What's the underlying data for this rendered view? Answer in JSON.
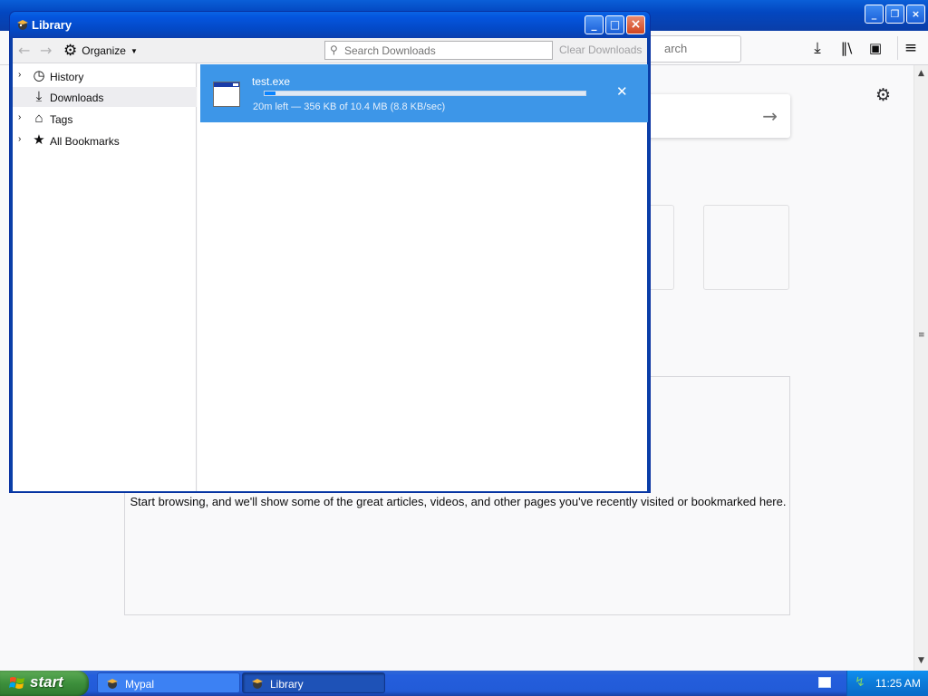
{
  "background_browser": {
    "search_placeholder": "arch",
    "new_tab_message": "Start browsing, and we'll show some of the great articles, videos, and other pages you've recently visited or bookmarked here."
  },
  "library": {
    "title": "Library",
    "toolbar": {
      "organize_label": "Organize",
      "search_placeholder": "Search Downloads",
      "clear_downloads_label": "Clear Downloads"
    },
    "sidebar": {
      "items": [
        {
          "label": "History",
          "icon": "clock-icon",
          "expandable": true
        },
        {
          "label": "Downloads",
          "icon": "download-icon",
          "expandable": false,
          "selected": true
        },
        {
          "label": "Tags",
          "icon": "tag-icon",
          "expandable": true
        },
        {
          "label": "All Bookmarks",
          "icon": "star-icon",
          "expandable": true
        }
      ]
    },
    "downloads": [
      {
        "filename": "test.exe",
        "status": "20m left — 356 KB of 10.4 MB (8.8 KB/sec)",
        "progress_fraction": 0.034
      }
    ]
  },
  "taskbar": {
    "start_label": "start",
    "tasks": [
      {
        "label": "Mypal",
        "active": false
      },
      {
        "label": "Library",
        "active": true
      }
    ],
    "clock": "11:25 AM"
  },
  "colors": {
    "selection": "#3d96e8",
    "xp_title_blue": "#0348c4",
    "start_green": "#3c8f3b"
  }
}
